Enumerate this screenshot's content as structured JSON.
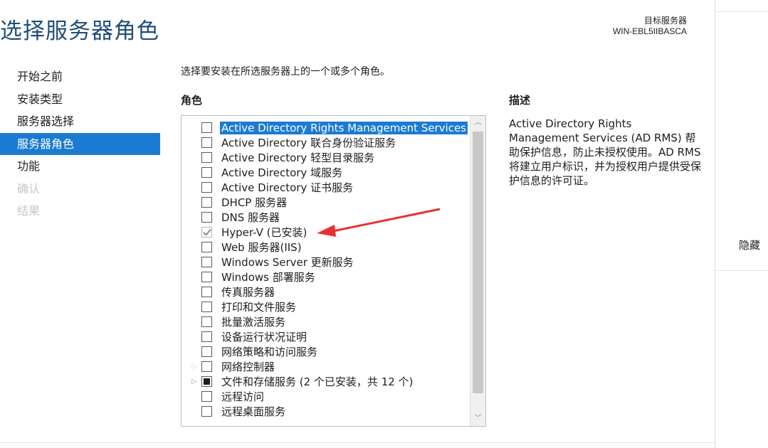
{
  "header": {
    "title": "选择服务器角色",
    "target_label": "目标服务器",
    "target_name": "WIN-EBL5IIBASCA"
  },
  "nav": {
    "items": [
      {
        "label": "开始之前",
        "state": "normal"
      },
      {
        "label": "安装类型",
        "state": "normal"
      },
      {
        "label": "服务器选择",
        "state": "normal"
      },
      {
        "label": "服务器角色",
        "state": "active"
      },
      {
        "label": "功能",
        "state": "normal"
      },
      {
        "label": "确认",
        "state": "disabled"
      },
      {
        "label": "结果",
        "state": "disabled"
      }
    ]
  },
  "main": {
    "instruction": "选择要安装在所选服务器上的一个或多个角色。",
    "roles_heading": "角色",
    "description_heading": "描述",
    "description_text": "Active Directory Rights Management Services (AD RMS) 帮助保护信息，防止未授权使用。AD RMS 将建立用户标识，并为授权用户提供受保护信息的许可证。",
    "roles": [
      {
        "label": "Active Directory Rights Management Services",
        "state": "unchecked",
        "selected": true
      },
      {
        "label": "Active Directory 联合身份验证服务",
        "state": "unchecked"
      },
      {
        "label": "Active Directory 轻型目录服务",
        "state": "unchecked"
      },
      {
        "label": "Active Directory 域服务",
        "state": "unchecked"
      },
      {
        "label": "Active Directory 证书服务",
        "state": "unchecked"
      },
      {
        "label": "DHCP 服务器",
        "state": "unchecked"
      },
      {
        "label": "DNS 服务器",
        "state": "unchecked"
      },
      {
        "label": "Hyper-V (已安装)",
        "state": "checked-disabled"
      },
      {
        "label": "Web 服务器(IIS)",
        "state": "unchecked"
      },
      {
        "label": "Windows Server 更新服务",
        "state": "unchecked"
      },
      {
        "label": "Windows 部署服务",
        "state": "unchecked"
      },
      {
        "label": "传真服务器",
        "state": "unchecked"
      },
      {
        "label": "打印和文件服务",
        "state": "unchecked"
      },
      {
        "label": "批量激活服务",
        "state": "unchecked"
      },
      {
        "label": "设备运行状况证明",
        "state": "unchecked"
      },
      {
        "label": "网络策略和访问服务",
        "state": "unchecked"
      },
      {
        "label": "网络控制器",
        "state": "unchecked",
        "expander": "collapsed-faint"
      },
      {
        "label": "文件和存储服务 (2 个已安装，共 12 个)",
        "state": "partial",
        "expander": "collapsed"
      },
      {
        "label": "远程访问",
        "state": "unchecked"
      },
      {
        "label": "远程桌面服务",
        "state": "unchecked"
      }
    ]
  },
  "right_pane": {
    "hide_label": "隐藏"
  },
  "colors": {
    "accent": "#1c7bd1",
    "title": "#1f4e79",
    "annotation_arrow": "#e8312f"
  }
}
